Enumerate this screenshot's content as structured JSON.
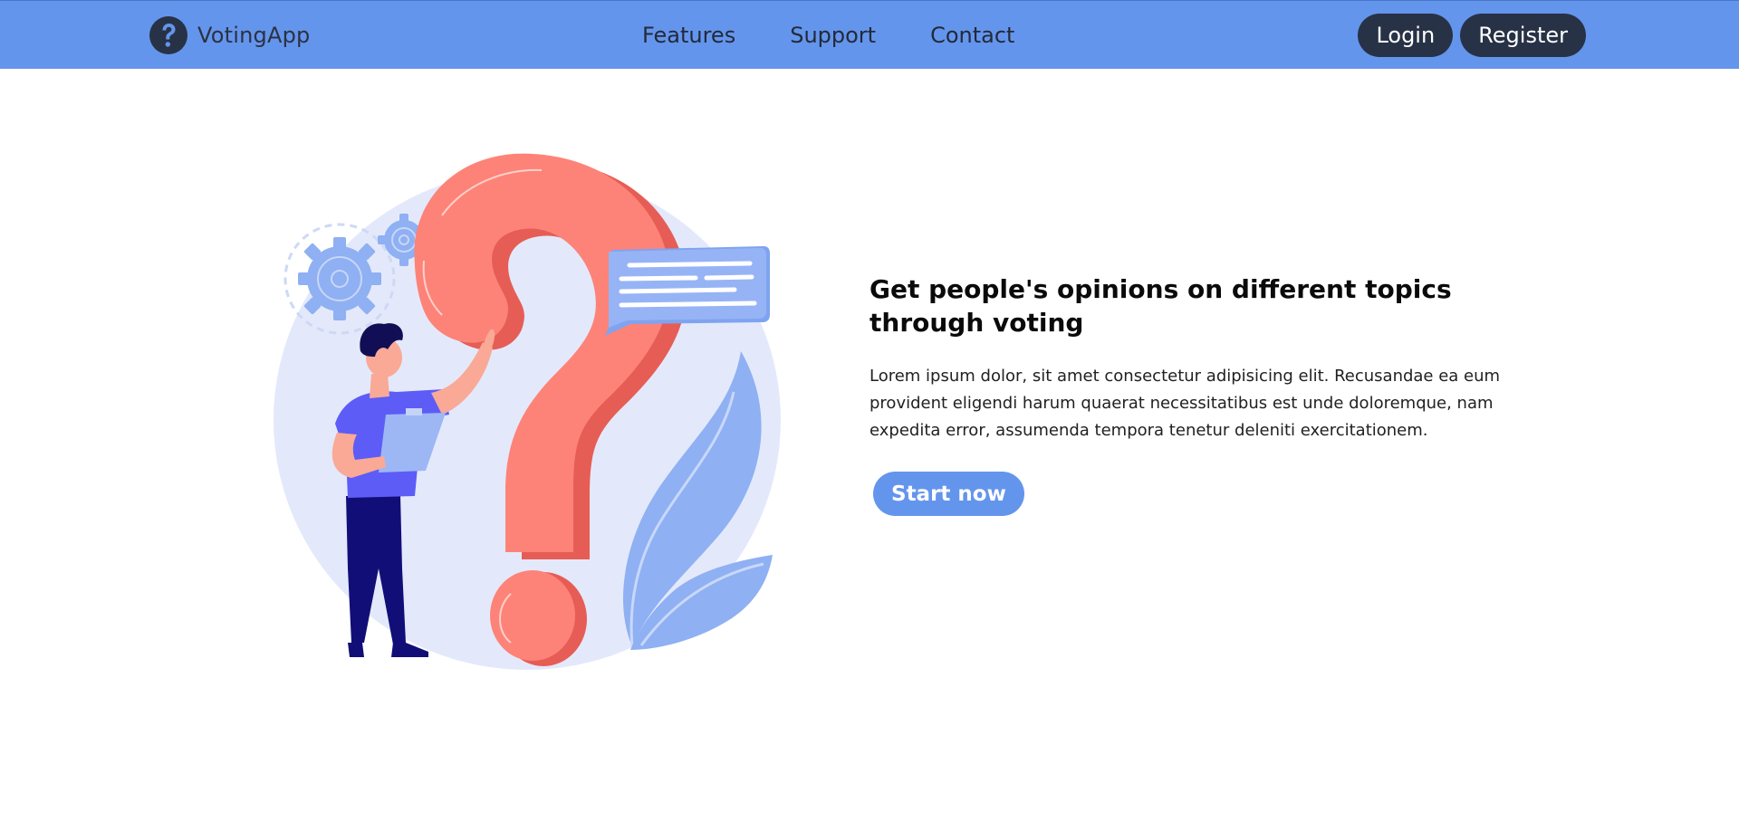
{
  "brand": {
    "name": "VotingApp",
    "icon": "question-mark-circle-icon"
  },
  "nav": {
    "links": [
      {
        "label": "Features"
      },
      {
        "label": "Support"
      },
      {
        "label": "Contact"
      }
    ]
  },
  "auth": {
    "login_label": "Login",
    "register_label": "Register"
  },
  "hero": {
    "title": "Get people's opinions on different topics through voting",
    "description": "Lorem ipsum dolor, sit amet consectetur adipisicing elit. Recusandae ea eum provident eligendi harum quaerat necessitatibus est unde doloremque, nam expedita error, assumenda tempora tenetur deleniti exercitationem.",
    "cta_label": "Start now",
    "illustration": "person-with-question-mark-illustration"
  },
  "colors": {
    "navbar": "#6495ed",
    "dark_button": "#283246",
    "accent": "#6495ed",
    "question_mark": "#fd8378"
  }
}
